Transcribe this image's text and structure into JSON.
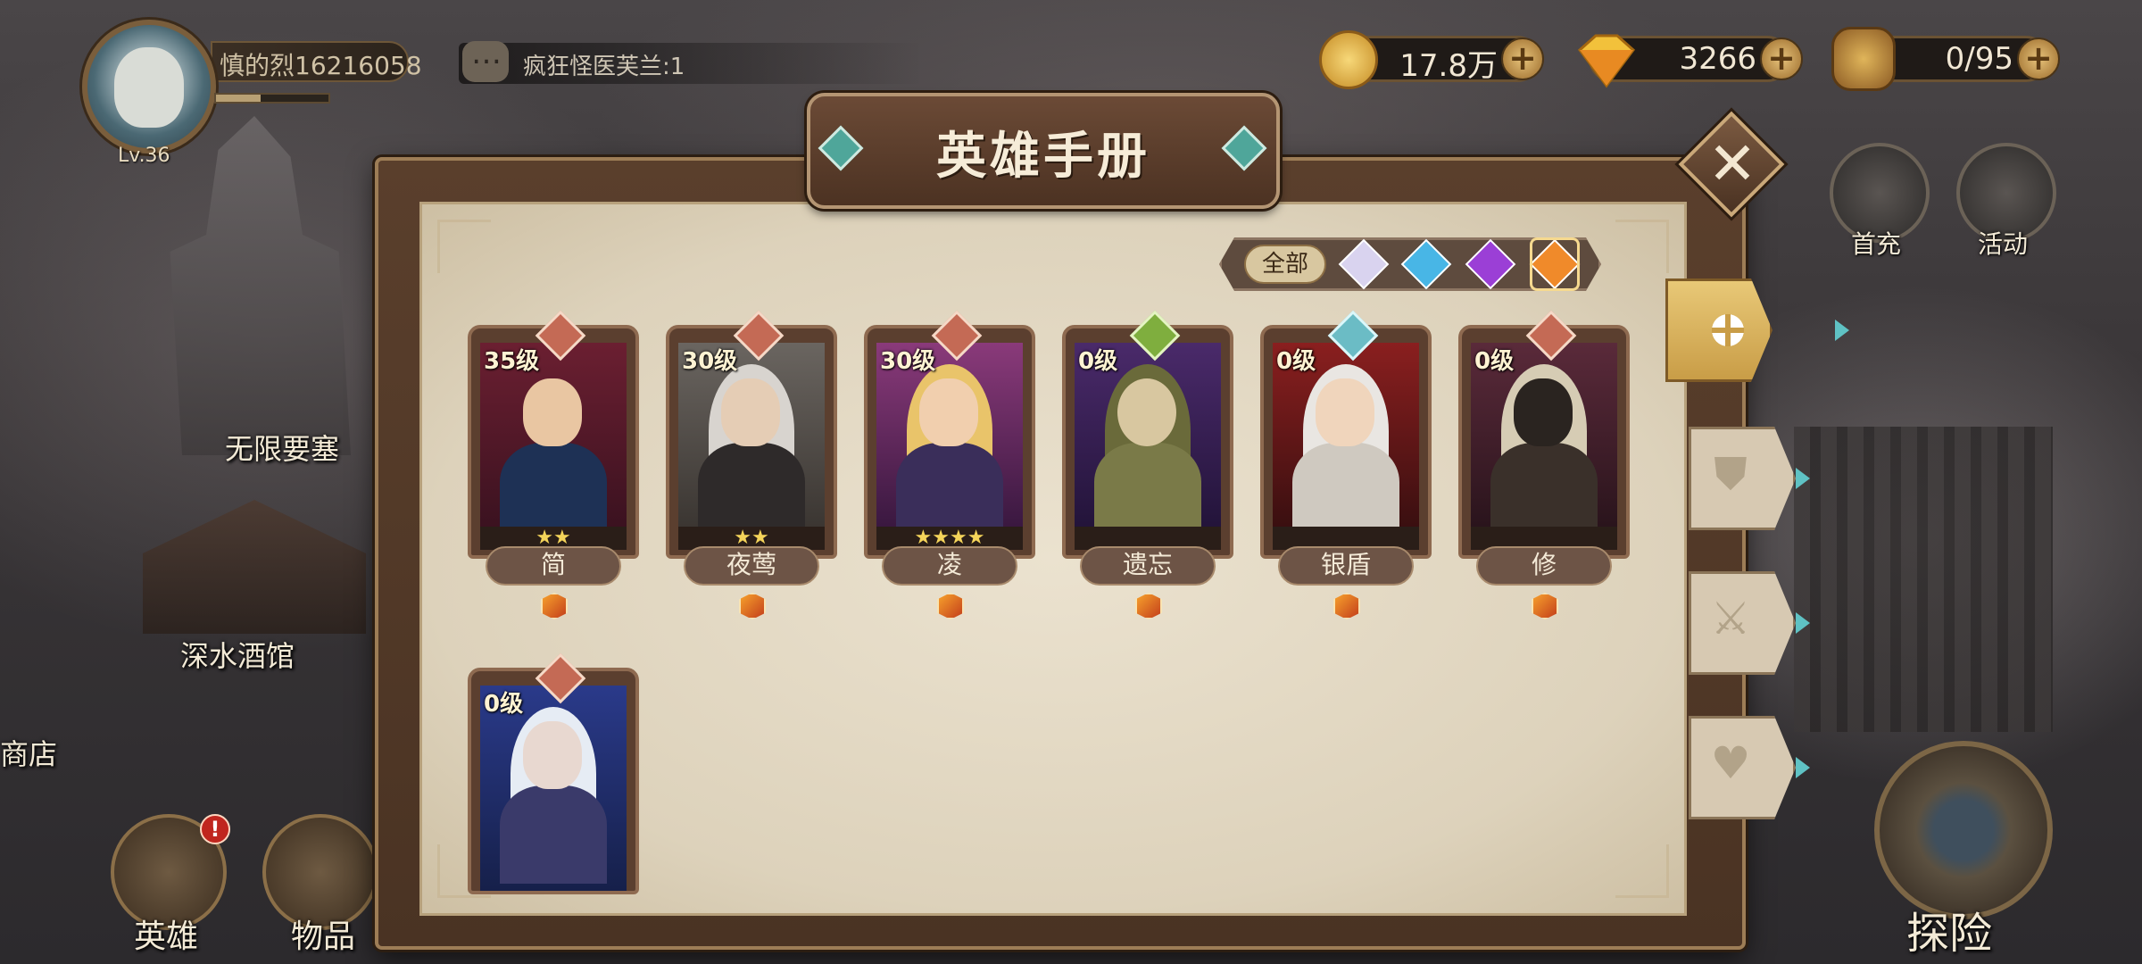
{
  "player": {
    "name": "慎的烈16216058",
    "level": "Lv.36",
    "xp_fraction": 0.4
  },
  "chat": {
    "message": "疯狂怪医芙兰:1"
  },
  "currencies": {
    "gold": "17.8万",
    "diamonds": "3266",
    "stamina": "0/95"
  },
  "top_buttons": {
    "first_recharge": "首充",
    "events": "活动"
  },
  "map": {
    "fortress": "无限要塞",
    "tavern": "深水酒馆",
    "shop": "商店"
  },
  "bottom_nav": {
    "heroes": "英雄",
    "heroes_badge": "!",
    "items": "物品",
    "explore": "探险"
  },
  "modal": {
    "title": "英雄手册",
    "filter_all": "全部"
  },
  "heroes": [
    {
      "level": "35级",
      "stars": "★★",
      "name": "简",
      "type": "attack"
    },
    {
      "level": "30级",
      "stars": "★★",
      "name": "夜莺",
      "type": "attack"
    },
    {
      "level": "30级",
      "stars": "★★★★",
      "name": "凌",
      "type": "attack"
    },
    {
      "level": "0级",
      "stars": "",
      "name": "遗忘",
      "type": "support"
    },
    {
      "level": "0级",
      "stars": "",
      "name": "银盾",
      "type": "defense"
    },
    {
      "level": "0级",
      "stars": "",
      "name": "修",
      "type": "attack"
    },
    {
      "level": "0级",
      "stars": "",
      "name": "",
      "type": "attack"
    }
  ],
  "colors": {
    "accent_gold": "#e8c877",
    "paper": "#e2d8c3",
    "frame_brown": "#5a3f2c",
    "teal_gem": "#4fa69a"
  }
}
